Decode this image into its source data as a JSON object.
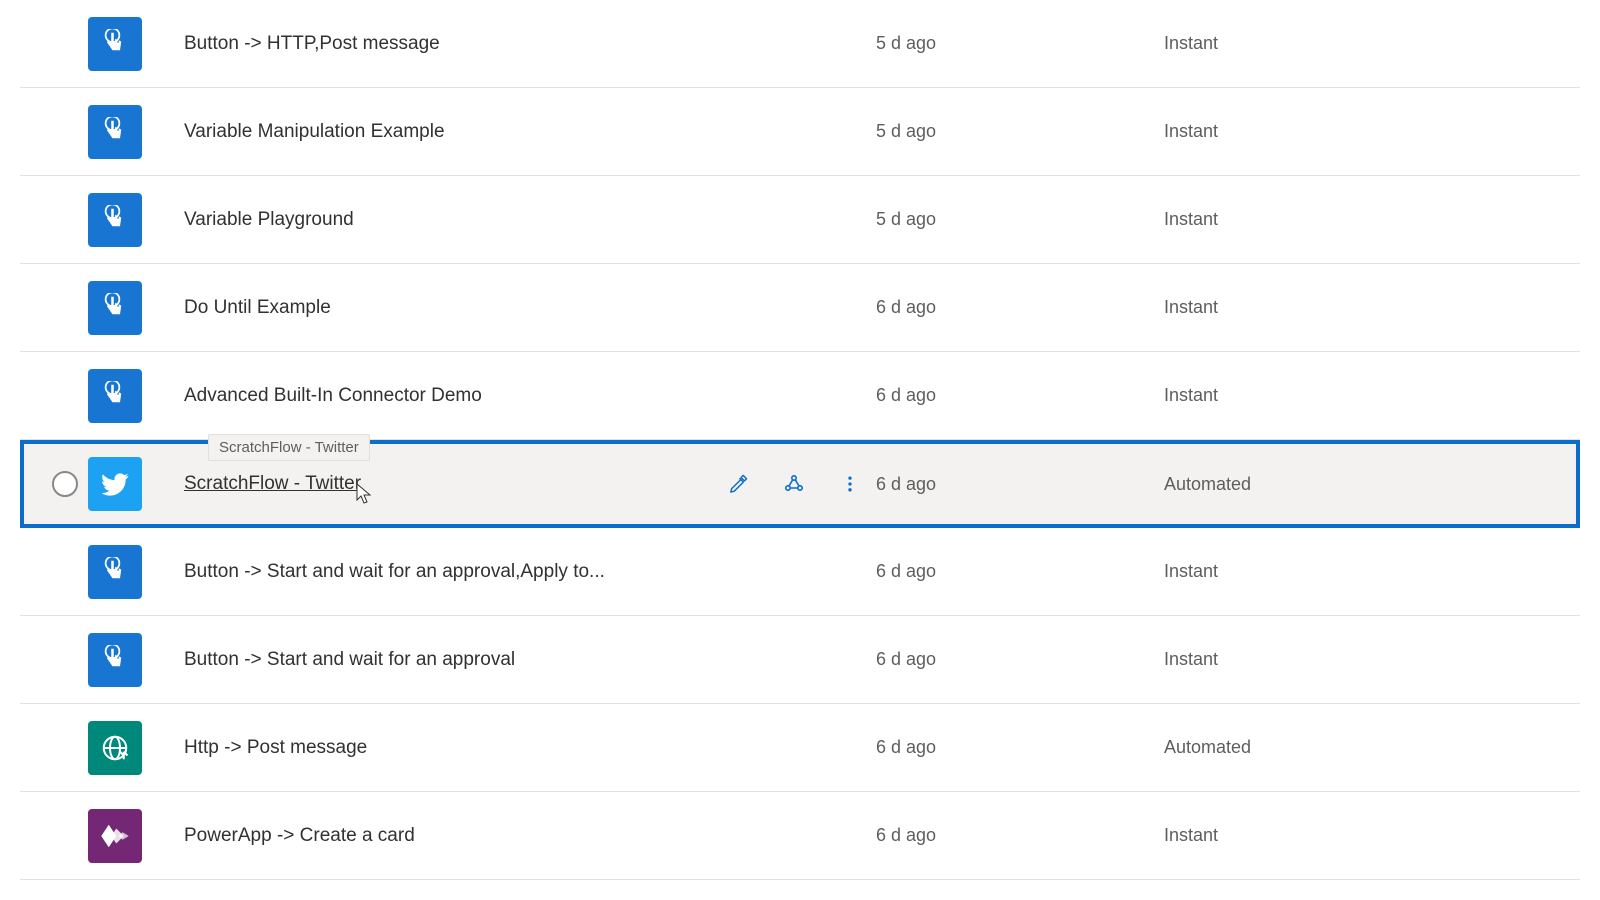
{
  "flows": [
    {
      "name": "Button -> HTTP,Post message",
      "modified": "5 d ago",
      "type": "Instant",
      "icon": "button",
      "selected": false
    },
    {
      "name": "Variable Manipulation Example",
      "modified": "5 d ago",
      "type": "Instant",
      "icon": "button",
      "selected": false
    },
    {
      "name": "Variable Playground",
      "modified": "5 d ago",
      "type": "Instant",
      "icon": "button",
      "selected": false
    },
    {
      "name": "Do Until Example",
      "modified": "6 d ago",
      "type": "Instant",
      "icon": "button",
      "selected": false
    },
    {
      "name": "Advanced Built-In Connector Demo",
      "modified": "6 d ago",
      "type": "Instant",
      "icon": "button",
      "selected": false
    },
    {
      "name": "ScratchFlow - Twitter",
      "modified": "6 d ago",
      "type": "Automated",
      "icon": "twitter",
      "selected": true,
      "tooltip": "ScratchFlow - Twitter"
    },
    {
      "name": "Button -> Start and wait for an approval,Apply to...",
      "modified": "6 d ago",
      "type": "Instant",
      "icon": "button",
      "selected": false
    },
    {
      "name": "Button -> Start and wait for an approval",
      "modified": "6 d ago",
      "type": "Instant",
      "icon": "button",
      "selected": false
    },
    {
      "name": "Http -> Post message",
      "modified": "6 d ago",
      "type": "Automated",
      "icon": "http",
      "selected": false
    },
    {
      "name": "PowerApp -> Create a card",
      "modified": "6 d ago",
      "type": "Instant",
      "icon": "powerapps",
      "selected": false
    }
  ],
  "iconColors": {
    "button": "#1876d2",
    "twitter": "#1da1f2",
    "http": "#00897b",
    "powerapps": "#742774"
  },
  "actionColor": "#0d6dca"
}
